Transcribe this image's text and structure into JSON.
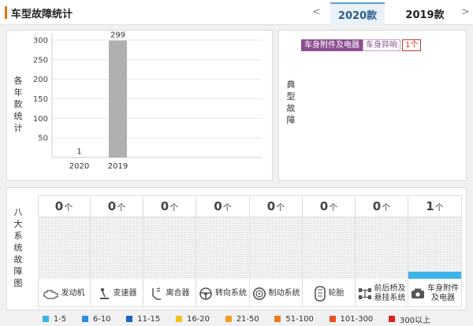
{
  "header": {
    "title": "车型故障统计",
    "prev_arrow": "<",
    "next_arrow": ">",
    "tabs": [
      {
        "label": "2020款",
        "active": true
      },
      {
        "label": "2019款",
        "active": false
      }
    ]
  },
  "left_panel": {
    "vertical_label": [
      "各",
      "年",
      "款",
      "统",
      "计"
    ]
  },
  "chart_data": {
    "type": "bar",
    "categories": [
      "2020",
      "2019"
    ],
    "values": [
      1,
      299
    ],
    "ylim": [
      0,
      310
    ],
    "yticks": [
      50,
      100,
      150,
      200,
      250,
      300
    ],
    "bar_color": "#b0b0b0",
    "grid": true
  },
  "typical_faults": {
    "vertical_label": [
      "典",
      "型",
      "故",
      "障"
    ],
    "tags": [
      "车身附件及电器",
      "车身异响"
    ],
    "count": "1个"
  },
  "systems": {
    "vertical_label": [
      "八",
      "大",
      "系",
      "统",
      "故",
      "障",
      "图"
    ],
    "unit": "个",
    "items": [
      {
        "name": "发动机",
        "count": "0",
        "level": 0,
        "icon": "engine-icon"
      },
      {
        "name": "变速器",
        "count": "0",
        "level": 0,
        "icon": "gear-shift-icon"
      },
      {
        "name": "离合器",
        "count": "0",
        "level": 0,
        "icon": "clutch-pedal-icon"
      },
      {
        "name": "转向系统",
        "count": "0",
        "level": 0,
        "icon": "steering-wheel-icon"
      },
      {
        "name": "制动系统",
        "count": "0",
        "level": 0,
        "icon": "brake-disc-icon"
      },
      {
        "name": "轮胎",
        "count": "0",
        "level": 0,
        "icon": "tire-icon"
      },
      {
        "name": "前后桥及悬挂系统",
        "name_lines": [
          "前后桥及",
          "悬挂系统"
        ],
        "count": "0",
        "level": 0,
        "icon": "axle-icon"
      },
      {
        "name": "车身附件及电器",
        "name_lines": [
          "车身附件",
          "及电器"
        ],
        "count": "1",
        "level": 0.12,
        "icon": "car-accessory-icon"
      }
    ]
  },
  "legend": [
    {
      "label": "1-5",
      "color": "#3cb4e8"
    },
    {
      "label": "6-10",
      "color": "#2a8de0"
    },
    {
      "label": "11-15",
      "color": "#1f64c4"
    },
    {
      "label": "16-20",
      "color": "#f5c21c"
    },
    {
      "label": "21-50",
      "color": "#f39c23"
    },
    {
      "label": "51-100",
      "color": "#ef7a1a"
    },
    {
      "label": "101-300",
      "color": "#e8501b"
    },
    {
      "label": "300以上",
      "color": "#d9241d"
    }
  ]
}
